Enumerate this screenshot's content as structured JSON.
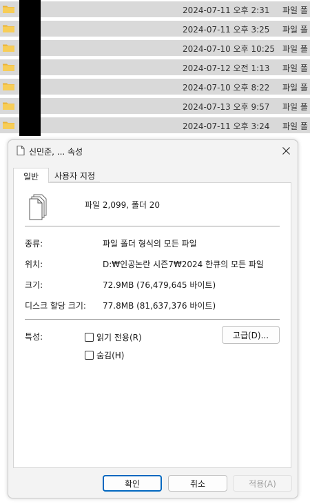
{
  "file_list": [
    {
      "date": "2024-07-11 오후 2:31",
      "type": "파일 폴"
    },
    {
      "date": "2024-07-11 오후 3:25",
      "type": "파일 폴"
    },
    {
      "date": "2024-07-10 오후 10:25",
      "type": "파일 폴"
    },
    {
      "date": "2024-07-12 오전 1:13",
      "type": "파일 폴"
    },
    {
      "date": "2024-07-10 오후 8:22",
      "type": "파일 폴"
    },
    {
      "date": "2024-07-13 오후 9:57",
      "type": "파일 폴"
    },
    {
      "date": "2024-07-11 오후 3:24",
      "type": "파일 폴"
    }
  ],
  "dialog": {
    "title": "신민준, ... 속성",
    "tabs": [
      "일반",
      "사용자 지정"
    ],
    "summary": "파일 2,099, 폴더 20",
    "type_label": "종류:",
    "type_value": "파일 폴더 형식의 모든 파일",
    "location_label": "위치:",
    "location_value": "D:₩인공논란 시즌7₩2024 한큐의 모든 파일",
    "size_label": "크기:",
    "size_value": "72.9MB (76,479,645 바이트)",
    "disk_label": "디스크 할당 크기:",
    "disk_value": "77.8MB (81,637,376 바이트)",
    "attributes_label": "특성:",
    "readonly_label": "읽기 전용(R)",
    "hidden_label": "숨김(H)",
    "advanced_label": "고급(D)...",
    "ok_label": "확인",
    "cancel_label": "취소",
    "apply_label": "적용(A)"
  }
}
